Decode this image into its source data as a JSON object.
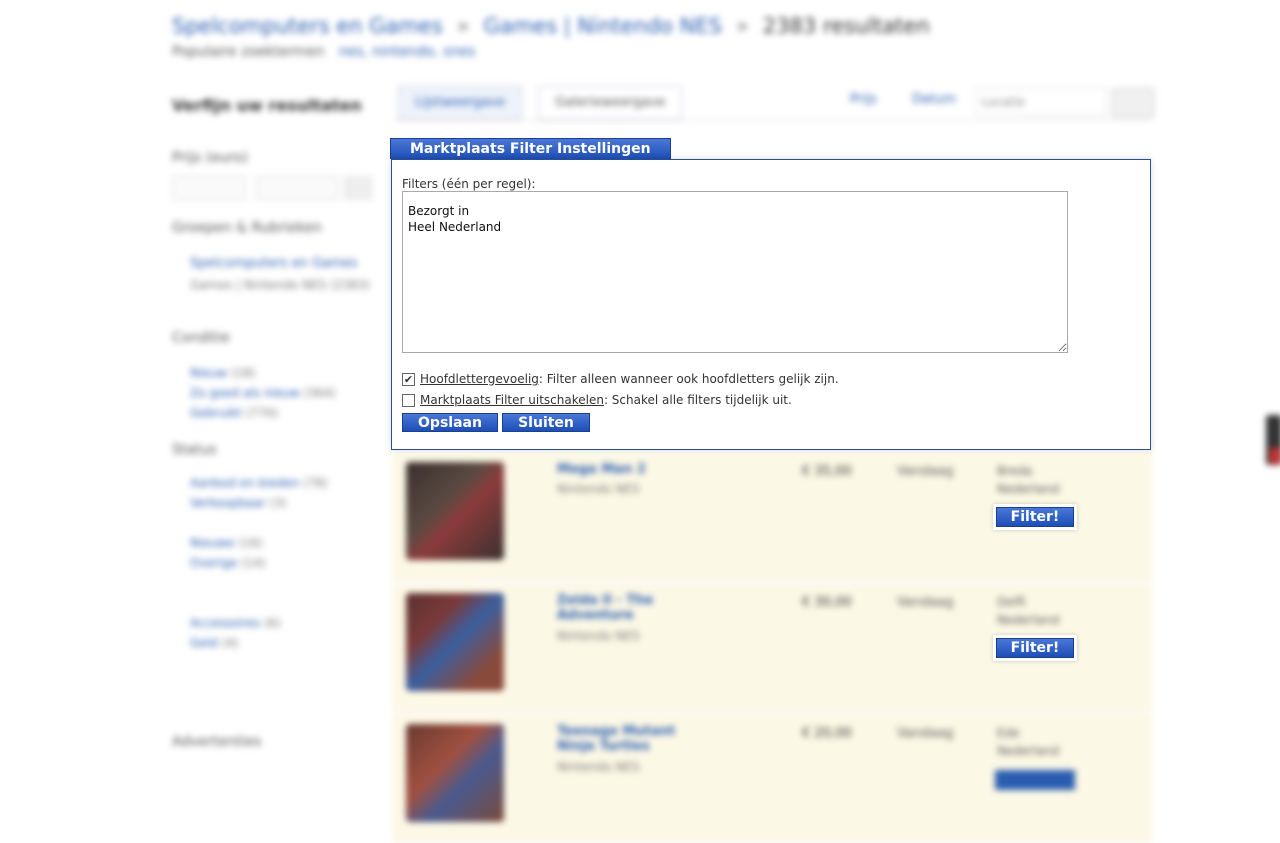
{
  "background": {
    "breadcrumb": [
      "Spelcomputers en Games",
      "Games | Nintendo NES",
      "2383 resultaten"
    ],
    "subline": [
      "Populaire zoektermen",
      "nes, nintendo, snes"
    ],
    "sidebar": {
      "title": "Verfijn uw resultaten",
      "headings": [
        "Prijs (euro)",
        "Groepen & Rubrieken",
        "Conditie",
        "Status",
        "Advertenties"
      ],
      "links": [
        {
          "label": "Spelcomputers en Games",
          "count": ""
        },
        {
          "label": "Games | Nintendo NES",
          "count": "(2383)"
        },
        {
          "label": "Nieuw",
          "count": "(18)"
        },
        {
          "label": "Zo goed als nieuw",
          "count": "(364)"
        },
        {
          "label": "Gebruikt",
          "count": "(770)"
        },
        {
          "label": "Aanbod en bieden",
          "count": "(78)"
        },
        {
          "label": "Verkoopbaar",
          "count": "(3)"
        },
        {
          "label": "Nieuwe",
          "count": "(16)"
        },
        {
          "label": "Overige",
          "count": "(14)"
        },
        {
          "label": "Accessoires",
          "count": "(6)"
        },
        {
          "label": "Geld",
          "count": "(4)"
        }
      ]
    },
    "tabs": [
      "Lijstweergave",
      "Galerieweergave"
    ],
    "toplinks": [
      "Prijs",
      "Datum",
      "Locatie"
    ],
    "listings": [
      {
        "title": "Mega Man 2",
        "desc": "Nintendo NES",
        "price": "€ 35,00",
        "date": "Vandaag",
        "loc": "Breda",
        "loc2": "Nederland"
      },
      {
        "title": "Zelda II - The Adventure",
        "desc": "Nintendo NES",
        "price": "€ 30,00",
        "date": "Vandaag",
        "loc": "Delft",
        "loc2": "Nederland"
      },
      {
        "title": "Teenage Mutant Ninja Turtles",
        "desc": "Nintendo NES",
        "price": "€ 20,00",
        "date": "Vandaag",
        "loc": "Ede",
        "loc2": "Nederland"
      }
    ]
  },
  "filter_panel": {
    "tab_title": "Marktplaats Filter Instellingen",
    "filters_label": "Filters (één per regel):",
    "filters_value": "Bezorgt in\nHeel Nederland",
    "option_case": {
      "link": "Hoofdlettergevoelig",
      "text": ": Filter alleen wanneer ook hoofdletters gelijk zijn.",
      "checked": true
    },
    "option_disable": {
      "link": "Marktplaats Filter uitschakelen",
      "text": ": Schakel alle filters tijdelijk uit.",
      "checked": false
    },
    "save_label": "Opslaan",
    "close_label": "Sluiten"
  },
  "filter_button_label": "Filter!",
  "colors": {
    "accent": "#1d4fb6",
    "listing_bg": "#fcf8e6",
    "link": "#2a5db0"
  }
}
